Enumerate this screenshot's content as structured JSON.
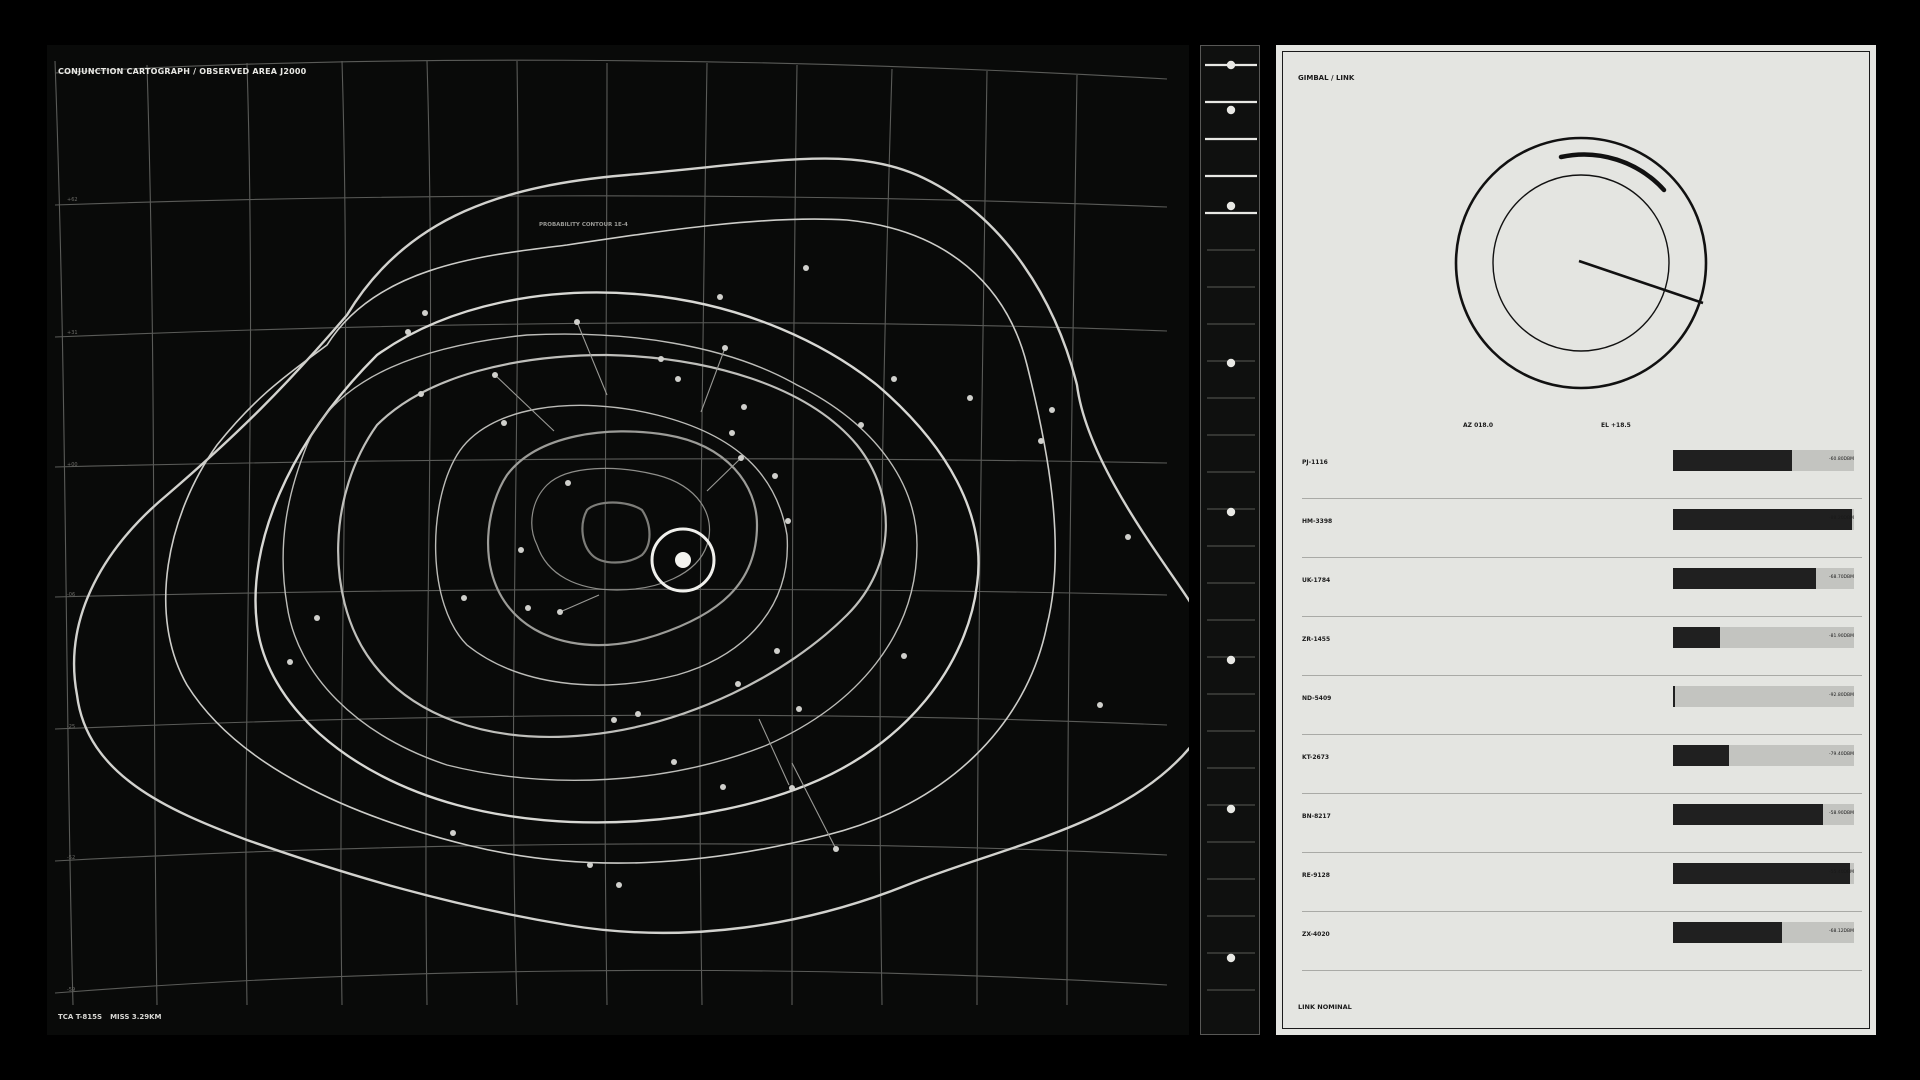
{
  "map": {
    "title": "CONJUNCTION CARTOGRAPH / OBSERVED AREA J2000",
    "contour_label": "PROBABILITY CONTOUR 1E-4",
    "footer": {
      "tca": "TCA T-815S",
      "miss": "MISS 3.29KM"
    },
    "lat_labels": [
      "+62",
      "+31",
      "+00",
      "-06",
      "-25",
      "-52",
      "-59"
    ]
  },
  "gimbal": {
    "title": "GIMBAL / LINK",
    "az": "AZ 018.0",
    "el": "EL +18.5",
    "status": "LINK NOMINAL",
    "links": [
      {
        "id": "PJ-1116",
        "value": "-60.80DBM",
        "level": 0.66
      },
      {
        "id": "HM-3398",
        "value": "-88.20DBM",
        "level": 0.99
      },
      {
        "id": "UK-1784",
        "value": "-68.70DBM",
        "level": 0.79
      },
      {
        "id": "ZR-1455",
        "value": "-81.90DBM",
        "level": 0.26
      },
      {
        "id": "ND-5409",
        "value": "-92.80DBM",
        "level": 0.01
      },
      {
        "id": "KT-2673",
        "value": "-79.40DBM",
        "level": 0.31
      },
      {
        "id": "BN-8217",
        "value": "-58.90DBM",
        "level": 0.83
      },
      {
        "id": "RE-9128",
        "value": "-55.40DBM",
        "level": 0.98
      },
      {
        "id": "ZX-4020",
        "value": "-68.12DBM",
        "level": 0.6
      }
    ]
  }
}
